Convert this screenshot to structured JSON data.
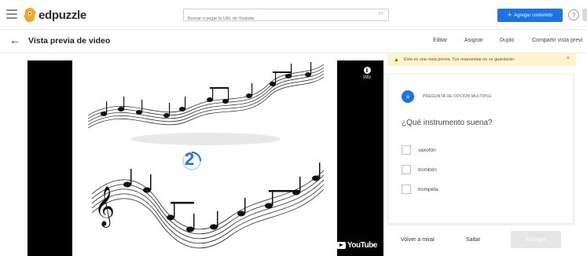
{
  "header": {
    "brand": "edpuzzle",
    "search_placeholder": "Buscar o pegar la URL de Youtube",
    "search_hint": "F1",
    "add_content_label": "Agregar contenido",
    "help_symbol": "?"
  },
  "subheader": {
    "title": "Vista previa de video",
    "tabs": [
      "Editar",
      "Asignar",
      "Duplo",
      "Compartir vista previ"
    ]
  },
  "warning": {
    "text": "Esta es una vista previa. Tus respuestas no se guardarán.",
    "close": "×"
  },
  "video": {
    "info_label": "Info",
    "provider": "YouTube",
    "overlay_number": "2"
  },
  "question": {
    "type_label": "PREGUNTA DE OPCION MULTIPLE",
    "text": "¿Qué instrumento suena?",
    "options": [
      "saxofón",
      "trombón",
      "trompeta"
    ]
  },
  "actions": {
    "rewatch": "Volver a mirar",
    "skip": "Saltar",
    "submit": "Entregar"
  },
  "colors": {
    "accent": "#1a73e8",
    "warning_bg": "#fff4cc",
    "logo": "#f5a623"
  }
}
